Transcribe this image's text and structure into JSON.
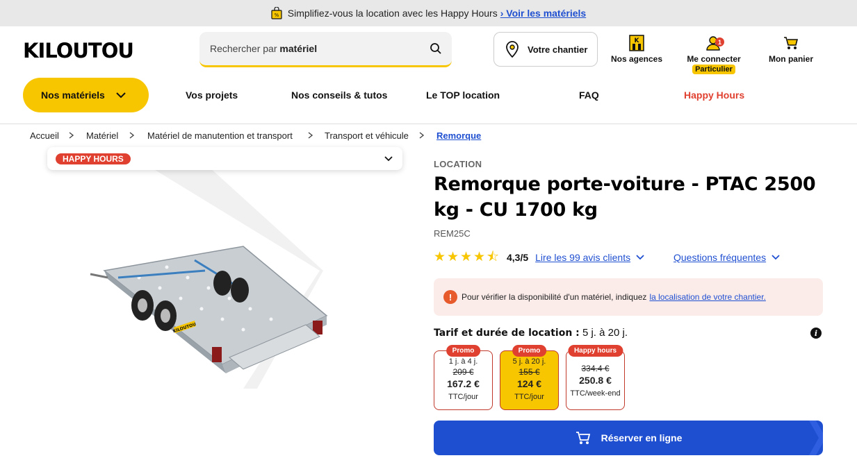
{
  "promo_bar": {
    "text": "Simplifiez-vous la location avec les Happy Hours",
    "link": "› Voir les matériels"
  },
  "header": {
    "logo": "KILOUTOU",
    "search": {
      "placeholder_prefix": "Rechercher par",
      "placeholder_bold": "matériel"
    },
    "chantier": "Votre chantier",
    "agences": "Nos agences",
    "connecter": "Me connecter",
    "connecter_badge": "Particulier",
    "notif_count": "1",
    "panier": "Mon panier"
  },
  "nav": {
    "main": "Nos matériels",
    "links": [
      "Vos projets",
      "Nos conseils & tutos",
      "Le TOP location",
      "FAQ",
      "Happy Hours"
    ]
  },
  "breadcrumb": [
    "Accueil",
    "Matériel",
    "Matériel de manutention et transport",
    "Transport et véhicule",
    "Remorque"
  ],
  "gallery": {
    "tag": "HAPPY HOURS",
    "trailer_brand": "KILOUTOU"
  },
  "product": {
    "kicker": "LOCATION",
    "title": "Remorque porte-voiture - PTAC 2500 kg - CU 1700 kg",
    "reference": "REM25C",
    "rating": {
      "stars": 4.3,
      "score": "4,3/5",
      "reviews_link": "Lire les 99 avis clients"
    },
    "faq_link": "Questions fréquentes",
    "alert": {
      "text": "Pour vérifier la disponibilité d'un matériel, indiquez",
      "link": "la localisation de votre chantier."
    },
    "tarif": {
      "label": "Tarif et durée de location :",
      "value": "5 j. à 20 j."
    },
    "pricing": [
      {
        "tag": "Promo",
        "duration": "1 j. à 4 j.",
        "old": "209 €",
        "price": "167.2 €",
        "unit": "TTC/jour",
        "selected": false
      },
      {
        "tag": "Promo",
        "duration": "5 j. à 20 j.",
        "old": "155 €",
        "price": "124 €",
        "unit": "TTC/jour",
        "selected": true
      },
      {
        "tag": "Happy hours",
        "duration": "",
        "old": "334.4 €",
        "price": "250.8 €",
        "unit": "TTC/week-end",
        "selected": false
      }
    ],
    "cta": "Réserver en ligne"
  },
  "colors": {
    "brand_yellow": "#f7c600",
    "accent_red": "#e0402f",
    "link_blue": "#1f4fd1"
  }
}
